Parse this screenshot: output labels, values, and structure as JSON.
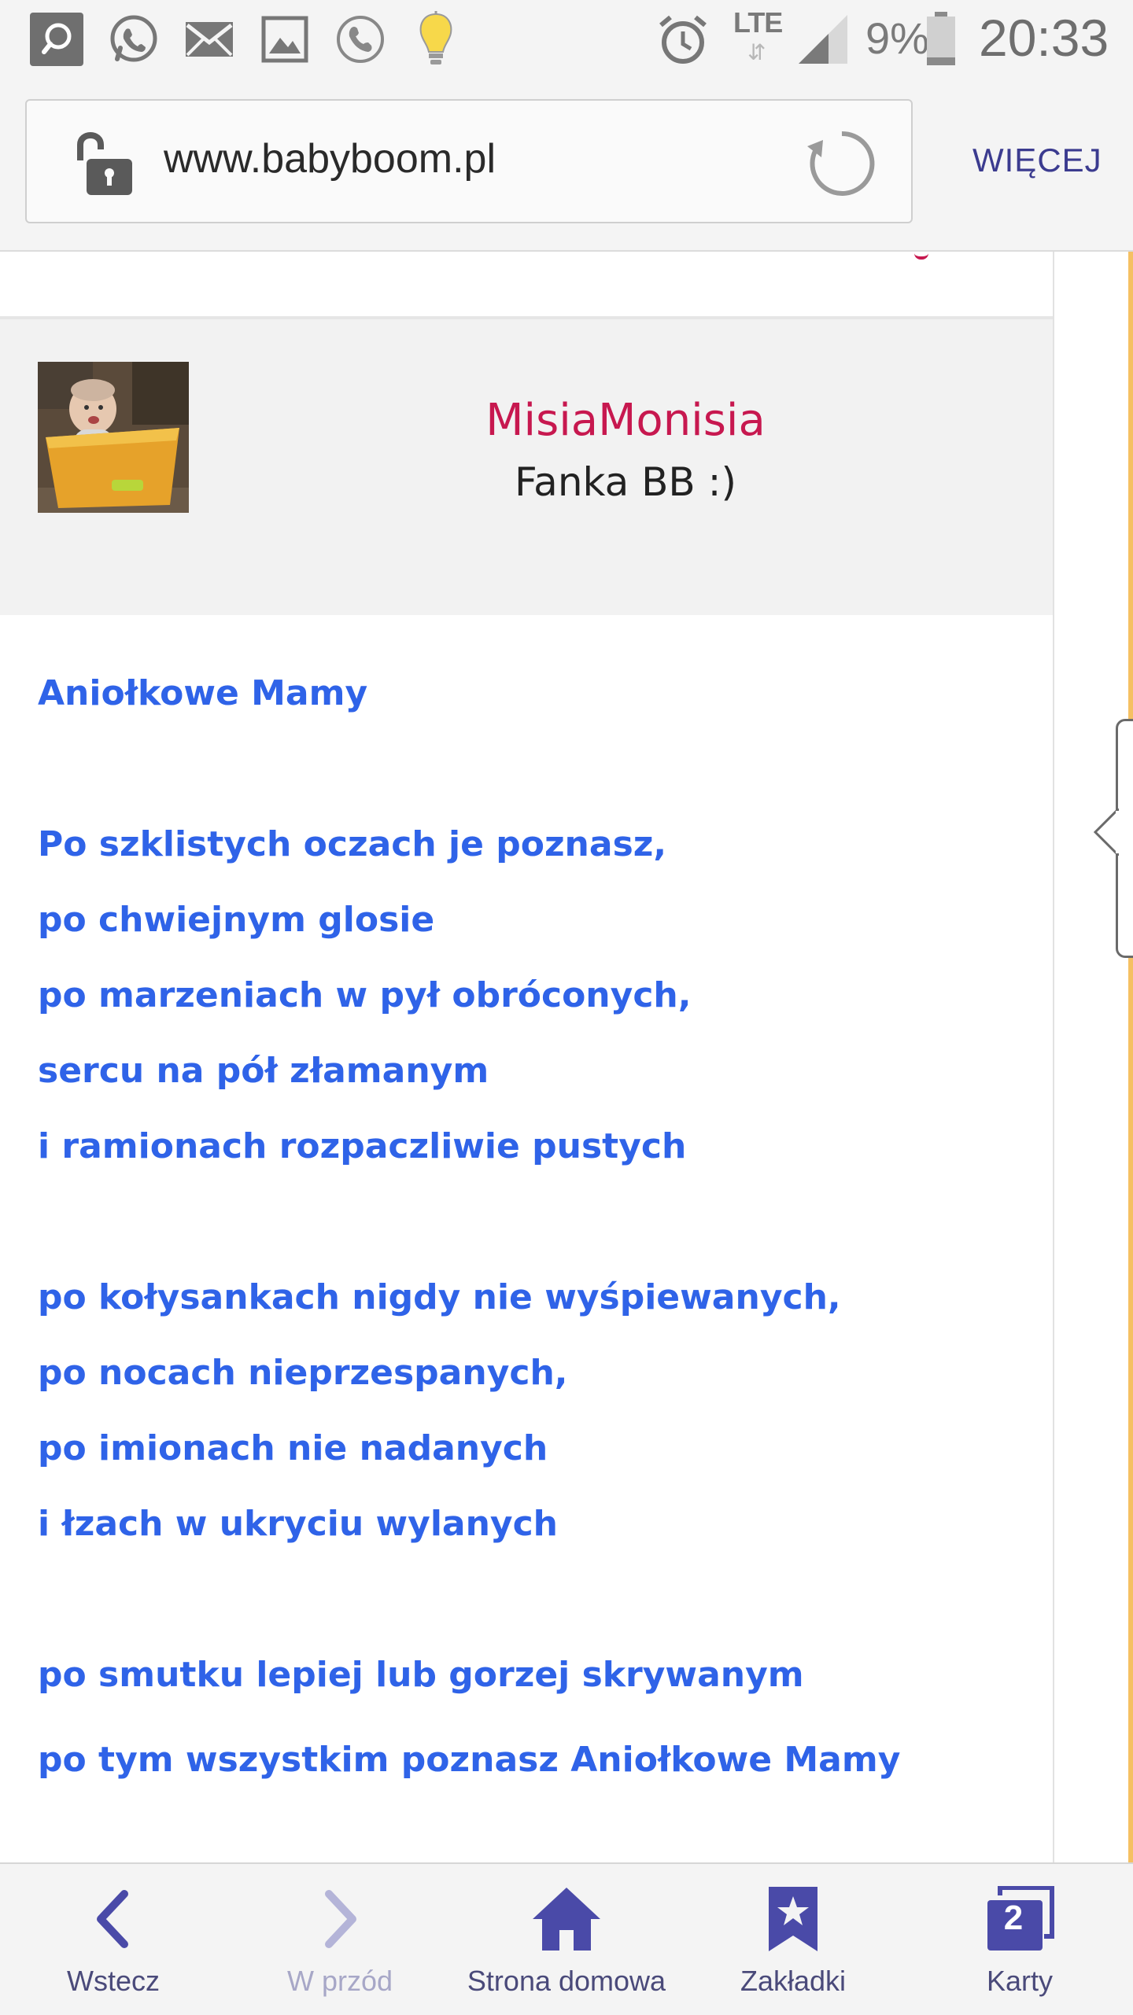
{
  "status_bar": {
    "icons": [
      "search-notification-icon",
      "whatsapp-icon",
      "email-icon",
      "gallery-icon",
      "call-icon",
      "lightbulb-icon"
    ],
    "network": "LTE",
    "battery_percent": "9%",
    "time": "20:33"
  },
  "address_bar": {
    "url": "www.babyboom.pl",
    "more_label": "WIĘCEJ"
  },
  "post": {
    "username": "MisiaMonisia",
    "rank": "Fanka BB :)",
    "lines": [
      "Aniołkowe Mamy",
      "",
      "Po szklistych oczach je poznasz,",
      "po chwiejnym glosie",
      "po marzeniach w pył obróconych,",
      "sercu na pół złamanym",
      "i ramionach rozpaczliwie pustych",
      "",
      "po kołysankach nigdy nie wyśpiewanych,",
      "po nocach nieprzespanych,",
      "po imionach nie nadanych",
      "i łzach w ukryciu wylanych",
      "",
      "po smutku lepiej lub gorzej skrywanym",
      "po tym wszystkim poznasz Aniołkowe Mamy"
    ]
  },
  "bottom_nav": {
    "back": "Wstecz",
    "forward": "W przód",
    "home": "Strona domowa",
    "bookmarks": "Zakładki",
    "tabs": "Karty",
    "tabs_count": "2"
  },
  "colors": {
    "username": "#c7184f",
    "poem_text": "#2f63e8",
    "nav_accent": "#4a4aa8",
    "more_button": "#3b3b8f"
  }
}
